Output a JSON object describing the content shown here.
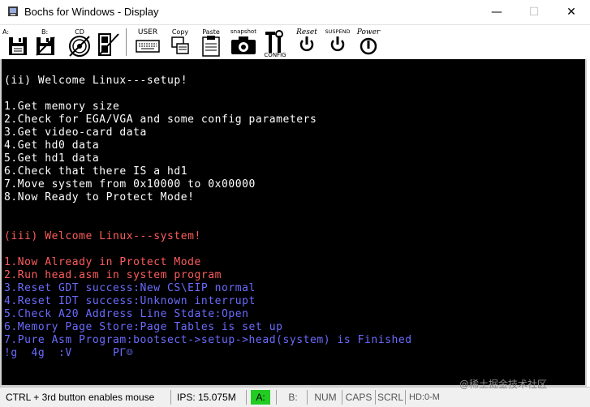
{
  "window": {
    "title": "Bochs for Windows - Display",
    "minimize_glyph": "—",
    "maximize_glyph": "☐",
    "close_glyph": "✕"
  },
  "toolbar": {
    "floppy_a": "A:",
    "floppy_b": "B:",
    "cdrom": "CD",
    "user": "USER",
    "copy": "Copy",
    "paste": "Paste",
    "snapshot": "snapshot",
    "config": "CONFIG",
    "reset": "Reset",
    "suspend": "SUSPEND",
    "power": "Power"
  },
  "console": {
    "lines": [
      {
        "text": "(ii) Welcome Linux---setup!",
        "color": "#ffffff"
      },
      {
        "text": "",
        "color": "#ffffff"
      },
      {
        "text": "1.Get memory size",
        "color": "#ffffff"
      },
      {
        "text": "2.Check for EGA/VGA and some config parameters",
        "color": "#ffffff"
      },
      {
        "text": "3.Get video-card data",
        "color": "#ffffff"
      },
      {
        "text": "4.Get hd0 data",
        "color": "#ffffff"
      },
      {
        "text": "5.Get hd1 data",
        "color": "#ffffff"
      },
      {
        "text": "6.Check that there IS a hd1",
        "color": "#ffffff"
      },
      {
        "text": "7.Move system from 0x10000 to 0x00000",
        "color": "#ffffff"
      },
      {
        "text": "8.Now Ready to Protect Mode!",
        "color": "#ffffff"
      },
      {
        "text": "",
        "color": "#ffffff"
      },
      {
        "text": "",
        "color": "#ffffff"
      },
      {
        "text": "(iii) Welcome Linux---system!",
        "color": "#ff5c5c"
      },
      {
        "text": "",
        "color": "#ffffff"
      },
      {
        "text": "1.Now Already in Protect Mode",
        "color": "#ff5c5c"
      },
      {
        "text": "2.Run head.asm in system program",
        "color": "#ff5c5c"
      },
      {
        "text": "3.Reset GDT success:New CS\\EIP normal",
        "color": "#6b6bff"
      },
      {
        "text": "4.Reset IDT success:Unknown interrupt",
        "color": "#6b6bff"
      },
      {
        "text": "5.Check A20 Address Line Stdate:Open",
        "color": "#6b6bff"
      },
      {
        "text": "6.Memory Page Store:Page Tables is set up",
        "color": "#6b6bff"
      },
      {
        "text": "7.Pure Asm Program:bootsect->setup->head(system) is Finished",
        "color": "#6b6bff"
      },
      {
        "text": "!g  4g  :V      PΓ☺",
        "color": "#6b6bff"
      }
    ]
  },
  "status": {
    "mouse_hint": "CTRL + 3rd button enables mouse",
    "ips": "IPS: 15.075M",
    "led_a": "A:",
    "led_b": "B:",
    "num": "NUM",
    "caps": "CAPS",
    "scrl": "SCRL",
    "hd": "HD:0-M",
    "led_a_color": "#22cc22"
  },
  "watermark": "@稀土掘金技术社区"
}
